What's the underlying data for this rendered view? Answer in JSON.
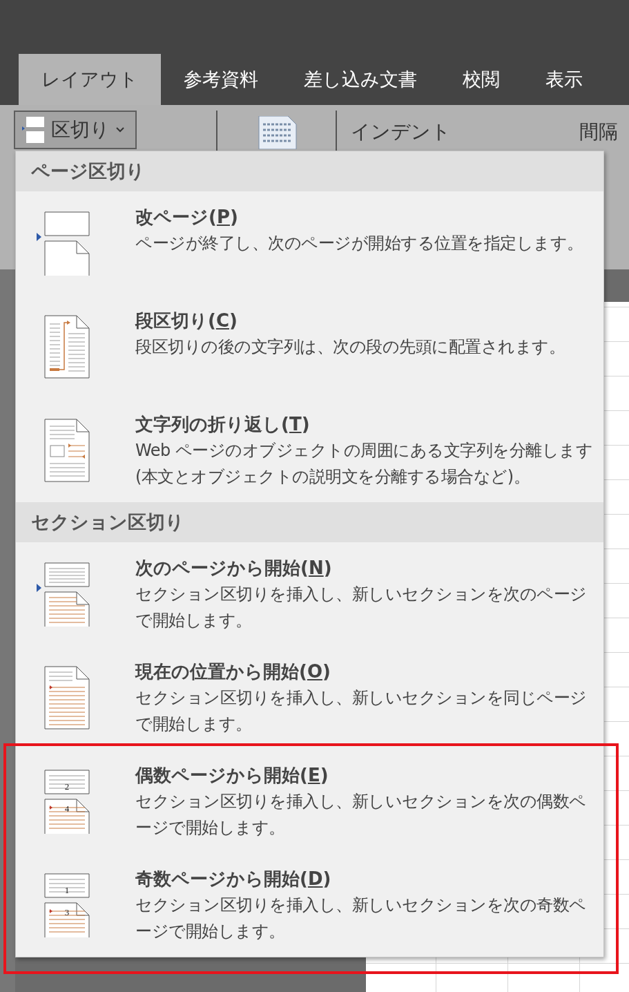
{
  "tabs": [
    {
      "label": "レイアウト",
      "selected": true
    },
    {
      "label": "参考資料",
      "selected": false
    },
    {
      "label": "差し込み文書",
      "selected": false
    },
    {
      "label": "校閲",
      "selected": false
    },
    {
      "label": "表示",
      "selected": false
    }
  ],
  "ribbon": {
    "breaks_button": "区切り",
    "indent_label": "インデント",
    "spacing_label": "間隔"
  },
  "menu": {
    "sections": [
      {
        "header": "ページ区切り",
        "items": [
          {
            "kind": "page-break",
            "title_before": "改ページ(",
            "accelerator": "P",
            "title_after": ")",
            "description": "ページが終了し、次のページが開始する位置を指定します。"
          },
          {
            "kind": "column-break",
            "title_before": "段区切り(",
            "accelerator": "C",
            "title_after": ")",
            "description": "段区切りの後の文字列は、次の段の先頭に配置されます。"
          },
          {
            "kind": "text-wrap",
            "title_before": "文字列の折り返し(",
            "accelerator": "T",
            "title_after": ")",
            "description": "Web ページのオブジェクトの周囲にある文字列を分離します (本文とオブジェクトの説明文を分離する場合など)。"
          }
        ]
      },
      {
        "header": "セクション区切り",
        "items": [
          {
            "kind": "next-page",
            "title_before": "次のページから開始(",
            "accelerator": "N",
            "title_after": ")",
            "description": "セクション区切りを挿入し、新しいセクションを次のページで開始します。"
          },
          {
            "kind": "continuous",
            "title_before": "現在の位置から開始(",
            "accelerator": "O",
            "title_after": ")",
            "description": "セクション区切りを挿入し、新しいセクションを同じページで開始します。"
          },
          {
            "kind": "numbered-pages",
            "page_numbers": [
              "2",
              "4"
            ],
            "title_before": "偶数ページから開始(",
            "accelerator": "E",
            "title_after": ")",
            "description": "セクション区切りを挿入し、新しいセクションを次の偶数ページで開始します。"
          },
          {
            "kind": "numbered-pages",
            "page_numbers": [
              "1",
              "3"
            ],
            "title_before": "奇数ページから開始(",
            "accelerator": "D",
            "title_after": ")",
            "description": "セクション区切りを挿入し、新しいセクションを次の奇数ページで開始します。"
          }
        ]
      }
    ]
  }
}
